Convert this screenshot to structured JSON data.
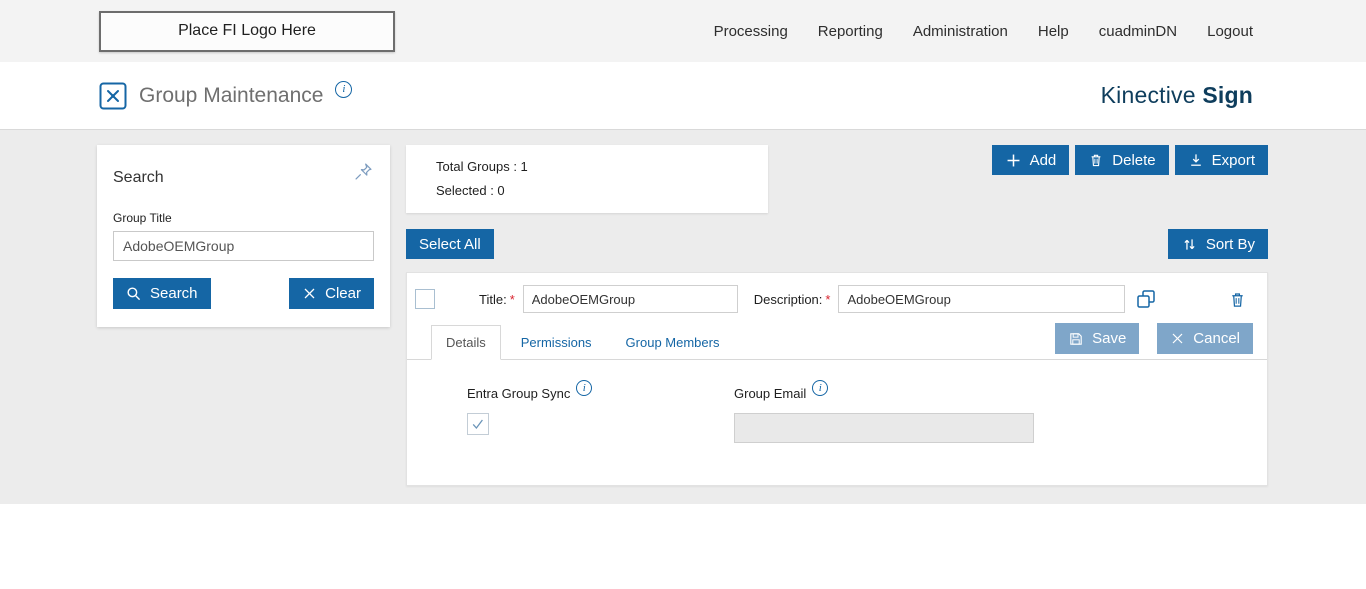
{
  "topbar": {
    "logo_placeholder": "Place FI Logo Here",
    "nav": [
      {
        "label": "Processing"
      },
      {
        "label": "Reporting"
      },
      {
        "label": "Administration"
      },
      {
        "label": "Help"
      },
      {
        "label": "cuadminDN"
      },
      {
        "label": "Logout"
      }
    ]
  },
  "header": {
    "title": "Group Maintenance",
    "brand_regular": "Kinective",
    "brand_bold": "Sign"
  },
  "search_panel": {
    "title": "Search",
    "group_title_label": "Group Title",
    "group_title_value": "AdobeOEMGroup",
    "search_button": "Search",
    "clear_button": "Clear"
  },
  "summary": {
    "total_groups_text": "Total Groups : 1",
    "selected_text": "Selected : 0"
  },
  "toolbar": {
    "add_label": "Add",
    "delete_label": "Delete",
    "export_label": "Export",
    "select_all_label": "Select All",
    "sort_by_label": "Sort By"
  },
  "group_row": {
    "title_label": "Title:",
    "required_mark": "*",
    "title_value": "AdobeOEMGroup",
    "description_label": "Description:",
    "description_value": "AdobeOEMGroup",
    "tabs": [
      {
        "label": "Details"
      },
      {
        "label": "Permissions"
      },
      {
        "label": "Group Members"
      }
    ],
    "save_label": "Save",
    "cancel_label": "Cancel",
    "details": {
      "entra_label": "Entra Group Sync",
      "email_label": "Group Email"
    }
  },
  "icons": {
    "info": "i"
  },
  "colors": {
    "primary_blue": "#1566a5",
    "muted_blue": "#7fa6c9",
    "brand_navy": "#0e3d5c",
    "required_red": "#d9232e",
    "content_bg": "#ececec",
    "topbar_bg": "#f3f3f3"
  }
}
